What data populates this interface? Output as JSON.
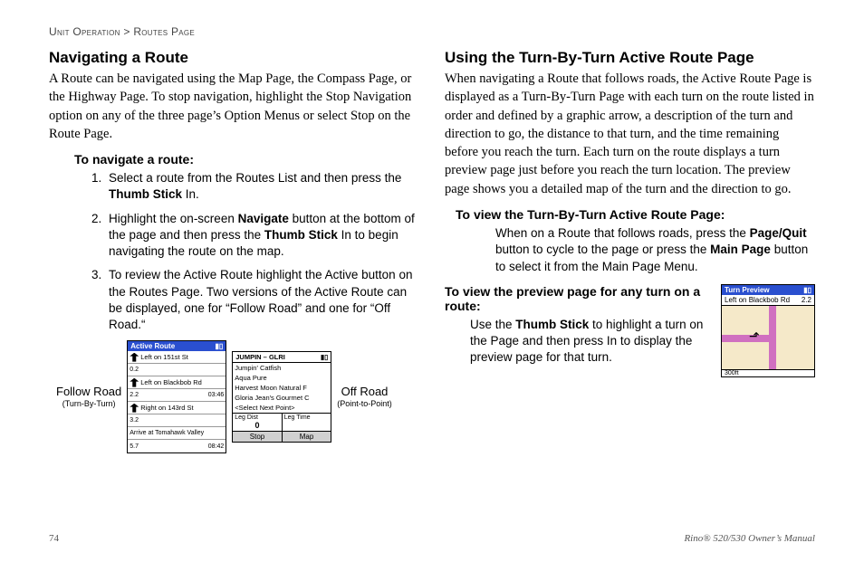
{
  "breadcrumb": {
    "section": "Unit Operation",
    "page": "Routes Page",
    "sep": " > "
  },
  "left": {
    "h": "Navigating a Route",
    "intro": "A Route can be navigated using the Map Page, the Compass Page, or the Highway Page. To stop navigation, highlight the Stop Navigation option on any of the three page’s Option Menus or select Stop on the Route Page.",
    "subhead": "To navigate a route:",
    "step1a": "Select a route from the Routes List and then press the ",
    "step1b": "Thumb Stick",
    "step1c": " In.",
    "step2a": "Highlight the on-screen ",
    "step2b": "Navigate",
    "step2c": " button at the bottom of the page and then press the ",
    "step2d": "Thumb Stick",
    "step2e": " In to begin navigating the route on the map.",
    "step3": "To review the Active Route highlight the Active button on the Routes Page. Two versions of the Active Route can be displayed, one for “Follow Road” and one for “Off Road.“",
    "figA_label": "Follow Road",
    "figA_sub": "(Turn-By-Turn)",
    "figB_label": "Off Road",
    "figB_sub": "(Point-to-Point)",
    "ssA": {
      "title": "Active Route",
      "rows": [
        {
          "dir": "Left on 151st St",
          "dist": "0.2",
          "time": ""
        },
        {
          "dir": "Left on Blackbob Rd",
          "dist": "2.2",
          "time": "03:46"
        },
        {
          "dir": "Right on 143rd St",
          "dist": "3.2",
          "time": ""
        },
        {
          "dir": "Arrive at Tomahawk Valley",
          "dist": "5.7",
          "time": "08:42"
        }
      ]
    },
    "ssB": {
      "title": "JUMPIN – GLRI",
      "pois": [
        "Jumpin' Catfish",
        "Aqua Pure",
        "Harvest Moon Natural F",
        "Gloria Jean's Gourmet C",
        "<Select Next Point>"
      ],
      "legdist_label": "Leg Dist",
      "legdist_val": "0",
      "legtime_label": "Leg Time",
      "legtime_val": "",
      "btn_stop": "Stop",
      "btn_map": "Map"
    }
  },
  "right": {
    "h": "Using the Turn-By-Turn Active Route Page",
    "intro": "When navigating a Route that follows roads, the Active Route Page is displayed as a Turn-By-Turn Page with each turn on the route listed in order and defined by a graphic arrow, a description of the turn and direction to go, the distance to that turn, and the time remaining before you reach the turn. Each turn on the route displays a turn preview page just before you reach the turn location. The preview page shows you a detailed map of the turn and the direction to go.",
    "sub1": "To view the Turn-By-Turn Active Route Page:",
    "sub1_a": "When on a Route that follows roads, press the ",
    "sub1_b": "Page/Quit",
    "sub1_c": " button to cycle to the page or press the ",
    "sub1_d": "Main Page",
    "sub1_e": " button to select it from the Main Page Menu.",
    "sub2": "To view the preview page for any turn on a route:",
    "sub2_a": "Use the ",
    "sub2_b": "Thumb Stick",
    "sub2_c": " to highlight a turn on the Page and then press In to display the preview page for that turn.",
    "preview": {
      "title": "Turn Preview",
      "dest": "Left on Blackbob Rd",
      "dist": "2.2",
      "scale": "300ft"
    }
  },
  "footer": {
    "page_num": "74",
    "manual": "Rino® 520/530 Owner’s Manual"
  }
}
